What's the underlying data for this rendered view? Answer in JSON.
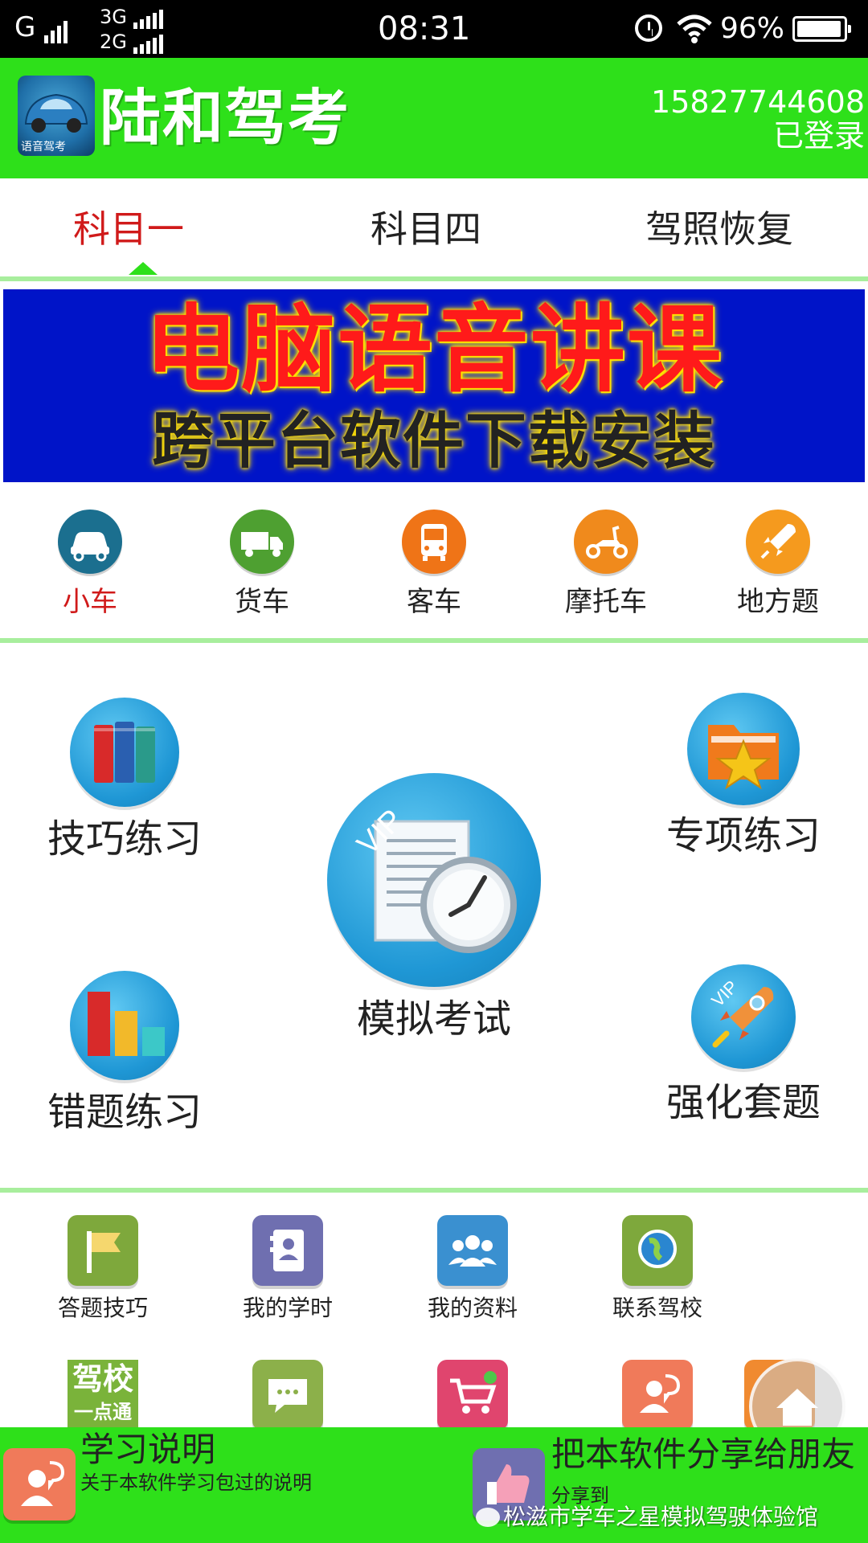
{
  "status_bar": {
    "carrier_g": "G",
    "net_3g": "3G",
    "net_2g": "2G",
    "time": "08:31",
    "battery_percent": "96%",
    "battery_level": 0.96,
    "icons": [
      "signal-icon",
      "alarm-icon",
      "wifi-icon",
      "battery-icon"
    ]
  },
  "header": {
    "title": "陆和驾考",
    "phone": "15827744608",
    "login_status": "已登录",
    "logo_caption": "语音驾考",
    "bg_color": "#2ee01a"
  },
  "tabs": [
    {
      "label": "科目一",
      "active": true
    },
    {
      "label": "科目四",
      "active": false
    },
    {
      "label": "驾照恢复",
      "active": false
    }
  ],
  "banner": {
    "line1": "电脑语音讲课",
    "line2": "跨平台软件下载安装"
  },
  "vehicles": [
    {
      "label": "小车",
      "icon": "car-icon",
      "color": "#1b6f8f",
      "active": true
    },
    {
      "label": "货车",
      "icon": "truck-icon",
      "color": "#4ea031",
      "active": false
    },
    {
      "label": "客车",
      "icon": "bus-icon",
      "color": "#ef7417",
      "active": false
    },
    {
      "label": "摩托车",
      "icon": "scooter-icon",
      "color": "#f08a1c",
      "active": false
    },
    {
      "label": "地方题",
      "icon": "rocket-icon",
      "color": "#f59a1e",
      "active": false
    }
  ],
  "features": {
    "skill": {
      "label": "技巧练习",
      "icon": "books-icon"
    },
    "special": {
      "label": "专项练习",
      "icon": "star-folder-icon"
    },
    "mock": {
      "label": "模拟考试",
      "icon": "exam-clock-icon",
      "badge": "VIP"
    },
    "wrong": {
      "label": "错题练习",
      "icon": "bar-chart-icon"
    },
    "intensive": {
      "label": "强化套题",
      "icon": "rocket-icon",
      "badge": "VIP"
    }
  },
  "tools_row1": [
    {
      "label": "答题技巧",
      "icon": "flag-icon",
      "color": "#7ea83c"
    },
    {
      "label": "我的学时",
      "icon": "contacts-book-icon",
      "color": "#6f6fb0"
    },
    {
      "label": "我的资料",
      "icon": "users-icon",
      "color": "#3a90d0"
    },
    {
      "label": "联系驾校",
      "icon": "globe-icon",
      "color": "#7ea83c"
    }
  ],
  "tools_row2": [
    {
      "label": "驾校",
      "sub": "一点通",
      "icon": "school-logo-icon",
      "color": "#7ab33a"
    },
    {
      "icon": "chat-icon",
      "color": "#8cb04a"
    },
    {
      "icon": "cart-icon",
      "color": "#e0456e"
    },
    {
      "icon": "user-chat-icon",
      "color": "#f07a5a"
    },
    {
      "icon": "orange-app-icon",
      "color": "#f08a30"
    }
  ],
  "footer": {
    "help_title": "学习说明",
    "help_sub": "关于本软件学习包过的说明",
    "share_title": "把本软件分享给朋友",
    "share_sub": "分享到",
    "watermark": "松滋市学车之星模拟驾驶体验馆"
  }
}
